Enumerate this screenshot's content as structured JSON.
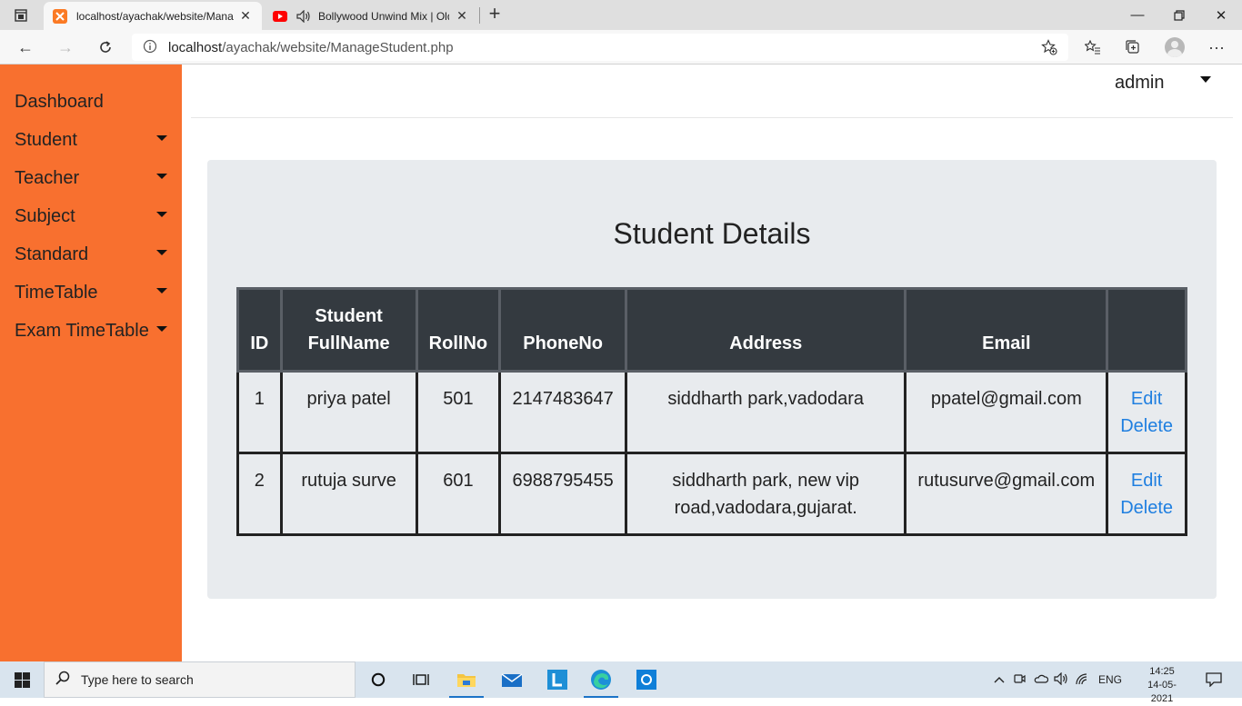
{
  "browser": {
    "tabs": [
      {
        "title": "localhost/ayachak/website/Mana",
        "active": true
      },
      {
        "title": "Bollywood Unwind Mix | Old",
        "active": false
      }
    ],
    "address": {
      "host": "localhost",
      "path": "/ayachak/website/ManageStudent.php"
    }
  },
  "sidebar": {
    "items": [
      {
        "label": "Dashboard",
        "dropdown": false
      },
      {
        "label": "Student",
        "dropdown": true
      },
      {
        "label": "Teacher",
        "dropdown": true
      },
      {
        "label": "Subject",
        "dropdown": true
      },
      {
        "label": "Standard",
        "dropdown": true
      },
      {
        "label": "TimeTable",
        "dropdown": true
      },
      {
        "label": "Exam TimeTable",
        "dropdown": true
      }
    ]
  },
  "header": {
    "user": "admin"
  },
  "main": {
    "title": "Student Details",
    "columns": [
      "ID",
      "Student FullName",
      "RollNo",
      "PhoneNo",
      "Address",
      "Email",
      ""
    ],
    "rows": [
      {
        "id": "1",
        "name": "priya patel",
        "roll": "501",
        "phone": "2147483647",
        "address": "siddharth park,vadodara",
        "email": "ppatel@gmail.com",
        "edit": "Edit",
        "delete": "Delete"
      },
      {
        "id": "2",
        "name": "rutuja surve",
        "roll": "601",
        "phone": "6988795455",
        "address": "siddharth park, new vip road,vadodara,gujarat.",
        "email": "rutusurve@gmail.com",
        "edit": "Edit",
        "delete": "Delete"
      }
    ]
  },
  "taskbar": {
    "search_placeholder": "Type here to search",
    "language": "ENG",
    "time": "14:25",
    "date": "14-05-2021"
  },
  "colors": {
    "sidebar": "#f8702f",
    "table_header": "#343a40",
    "link": "#1f7fe0",
    "panel": "#e8ebee"
  }
}
